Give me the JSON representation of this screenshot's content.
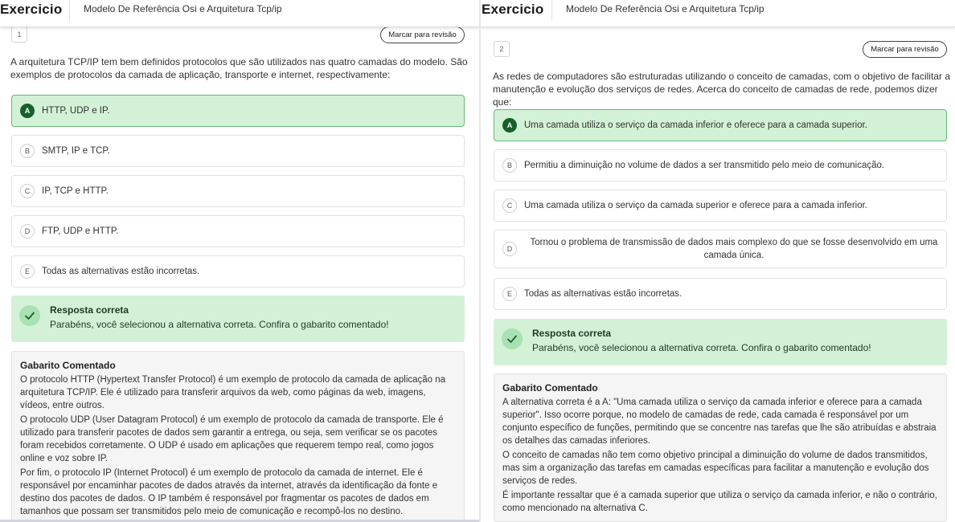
{
  "panels": [
    {
      "brand": "Exercicio",
      "course_title": "Modelo De Referência Osi e Arquitetura Tcp/ip",
      "question_number": "1",
      "mark_label": "Marcar para revisão",
      "stem": "A arquitetura TCP/IP tem bem definidos protocolos que são utilizados nas quatro camadas do modelo. São exemplos de protocolos da camada de aplicação, transporte e internet, respectivamente:",
      "options": [
        {
          "letter": "A",
          "text": "HTTP, UDP e IP."
        },
        {
          "letter": "B",
          "text": "SMTP, IP e TCP."
        },
        {
          "letter": "C",
          "text": "IP, TCP e HTTP."
        },
        {
          "letter": "D",
          "text": "FTP, UDP e HTTP."
        },
        {
          "letter": "E",
          "text": "Todas as alternativas estão incorretas."
        }
      ],
      "feedback_title": "Resposta correta",
      "feedback_msg": "Parabéns, você selecionou a alternativa correta. Confira o gabarito comentado!",
      "gabarito_title": "Gabarito Comentado",
      "gabarito_paragraphs": [
        "O protocolo HTTP (Hypertext Transfer Protocol) é um exemplo de protocolo da camada de aplicação na arquitetura TCP/IP. Ele é utilizado para transferir arquivos da web, como páginas da web, imagens, vídeos, entre outros.",
        "O protocolo UDP (User Datagram Protocol) é um exemplo de protocolo da camada de transporte. Ele é utilizado para transferir pacotes de dados sem garantir a entrega, ou seja, sem verificar se os pacotes foram recebidos corretamente. O UDP é usado em aplicações que requerem tempo real, como jogos online e voz sobre IP.",
        "Por fim, o protocolo IP (Internet Protocol) é um exemplo de protocolo da camada de internet. Ele é responsável por encaminhar pacotes de dados através da internet, através da identificação da fonte e destino dos pacotes de dados. O IP também é responsável por fragmentar os pacotes de dados em tamanhos que possam ser transmitidos pelo meio de comunicação e recompô-los no destino."
      ]
    },
    {
      "brand": "Exercicio",
      "course_title": "Modelo De Referência Osi e Arquitetura Tcp/ip",
      "question_number": "2",
      "mark_label": "Marcar para revisão",
      "stem": "As redes de computadores são estruturadas utilizando o conceito de camadas, com o objetivo de facilitar a manutenção e evolução dos serviços de redes. Acerca do conceito de camadas de rede, podemos dizer que:",
      "options": [
        {
          "letter": "A",
          "text": "Uma camada utiliza o serviço da camada inferior e oferece para a camada superior."
        },
        {
          "letter": "B",
          "text": "Permitiu a diminuição no volume de dados a ser transmitido pelo meio de comunicação."
        },
        {
          "letter": "C",
          "text": "Uma camada utiliza o serviço da camada superior e oferece para a camada inferior."
        },
        {
          "letter": "D",
          "text": "Tornou o problema de transmissão de dados mais complexo do que se fosse desenvolvido em uma camada única."
        },
        {
          "letter": "E",
          "text": "Todas as alternativas estão incorretas."
        }
      ],
      "feedback_title": "Resposta correta",
      "feedback_msg": "Parabéns, você selecionou a alternativa correta. Confira o gabarito comentado!",
      "gabarito_title": "Gabarito Comentado",
      "gabarito_paragraphs": [
        "A alternativa correta é a A: \"Uma camada utiliza o serviço da camada inferior e oferece para a camada superior\". Isso ocorre porque, no modelo de camadas de rede, cada camada é responsável por um conjunto específico de funções, permitindo que se concentre nas tarefas que lhe são atribuídas e abstraia os detalhes das camadas inferiores.",
        "O conceito de camadas não tem como objetivo principal a diminuição do volume de dados transmitidos, mas sim a organização das tarefas em camadas específicas para facilitar a manutenção e evolução dos serviços de redes.",
        "É importante ressaltar que é a camada superior que utiliza o serviço da camada inferior, e não o contrário, como mencionado na alternativa C."
      ]
    }
  ]
}
